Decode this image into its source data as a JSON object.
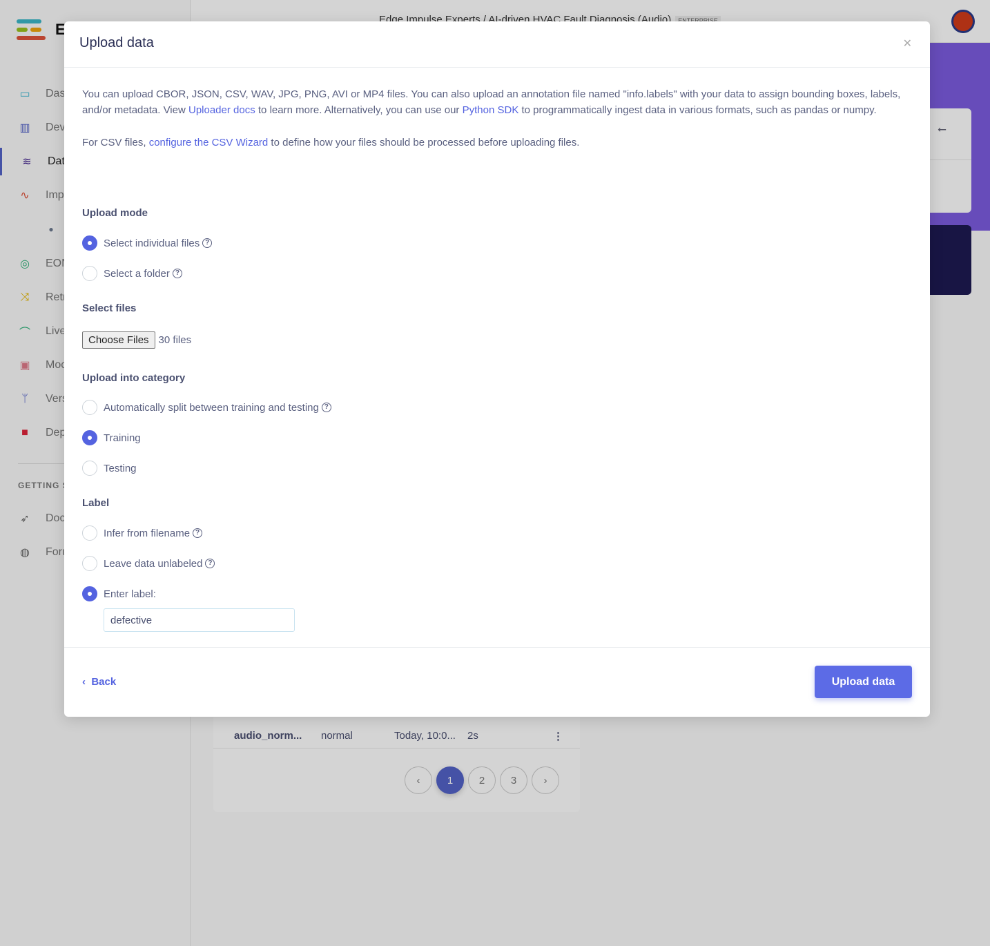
{
  "colors": {
    "accent": "#5463e0",
    "hero": "#7c5ce0"
  },
  "sidebar": {
    "brand_letter": "E",
    "items": [
      {
        "label": "Das",
        "icon": "monitor-icon",
        "color": "#3bb7d1"
      },
      {
        "label": "Dev",
        "icon": "chip-icon",
        "color": "#5463c8"
      },
      {
        "label": "Dat",
        "icon": "database-icon",
        "color": "#3c1a8a"
      },
      {
        "label": "Imp",
        "icon": "pulse-icon",
        "color": "#e0523a"
      },
      {
        "label": "",
        "icon": "dot-icon",
        "color": "#6d7a90"
      },
      {
        "label": "EON",
        "icon": "compass-icon",
        "color": "#2eb37a"
      },
      {
        "label": "Retr",
        "icon": "shuffle-icon",
        "color": "#e6b800"
      },
      {
        "label": "Live",
        "icon": "bezier-icon",
        "color": "#2eb37a"
      },
      {
        "label": "Moc",
        "icon": "clipboard-check-icon",
        "color": "#e07a8a"
      },
      {
        "label": "Vers",
        "icon": "branch-icon",
        "color": "#4a5ac8"
      },
      {
        "label": "Dep",
        "icon": "cube-icon",
        "color": "#e0243a"
      }
    ],
    "section_label": "GETTING S",
    "bottom_items": [
      {
        "label": "Doc",
        "icon": "rocket-icon",
        "color": "#666"
      },
      {
        "label": "Foru",
        "icon": "chat-icon",
        "color": "#666"
      }
    ]
  },
  "header": {
    "breadcrumb": "Edge Impulse Experts  /  AI-driven HVAC Fault Diagnosis (Audio)",
    "badge": "ENTERPRISE"
  },
  "background_list": {
    "row": {
      "name": "audio_norm...",
      "label": "normal",
      "added": "Today, 10:0...",
      "length": "2s"
    },
    "pages": [
      "1",
      "2",
      "3"
    ],
    "current_page": "1"
  },
  "modal": {
    "title": "Upload data",
    "intro_1": "You can upload CBOR, JSON, CSV, WAV, JPG, PNG, AVI or MP4 files. You can also upload an annotation file named \"info.labels\" with your data to assign bounding boxes, labels, and/or metadata. View ",
    "uploader_docs_link": "Uploader docs",
    "intro_2": " to learn more. Alternatively, you can use our ",
    "python_sdk_link": "Python SDK",
    "intro_3": " to programmatically ingest data in various formats, such as pandas or numpy.",
    "csv_1": "For CSV files, ",
    "csv_link": "configure the CSV Wizard",
    "csv_2": " to define how your files should be processed before uploading files.",
    "upload_mode_label": "Upload mode",
    "upload_mode_options": [
      {
        "label": "Select individual files",
        "selected": true
      },
      {
        "label": "Select a folder",
        "selected": false
      }
    ],
    "select_files_label": "Select files",
    "choose_files_button": "Choose Files",
    "files_status": "30 files",
    "category_label": "Upload into category",
    "category_options": [
      {
        "label": "Automatically split between training and testing",
        "selected": false
      },
      {
        "label": "Training",
        "selected": true
      },
      {
        "label": "Testing",
        "selected": false
      }
    ],
    "label_section": "Label",
    "label_options": [
      {
        "label": "Infer from filename",
        "selected": false
      },
      {
        "label": "Leave data unlabeled",
        "selected": false
      },
      {
        "label": "Enter label:",
        "selected": true
      }
    ],
    "label_value": "defective",
    "back_button": "Back",
    "upload_button": "Upload data"
  }
}
